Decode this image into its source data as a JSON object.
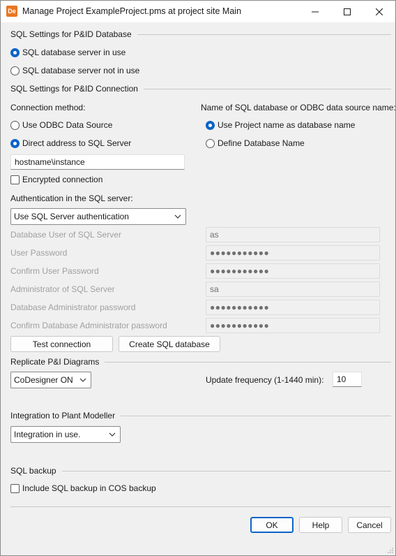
{
  "window": {
    "app_icon": "De",
    "title": "Manage Project ExampleProject.pms at project site Main"
  },
  "sql_db": {
    "heading": "SQL Settings for P&ID Database",
    "in_use": "SQL database server in use",
    "not_in_use": "SQL database server not in use"
  },
  "sql_conn": {
    "heading": "SQL Settings for P&ID Connection",
    "method_label": "Connection method:",
    "odbc": "Use ODBC Data Source",
    "direct": "Direct address to SQL Server",
    "server_value": "hostname\\instance",
    "encrypted": "Encrypted connection",
    "name_label": "Name of SQL database or ODBC data source name:",
    "use_project_name": "Use Project name as database name",
    "define_name": "Define Database Name",
    "auth_label": "Authentication in the SQL server:",
    "auth_value": "Use SQL Server authentication",
    "fields": [
      {
        "label": "Database User of SQL Server",
        "value": "as"
      },
      {
        "label": "User Password",
        "value": "●●●●●●●●●●●"
      },
      {
        "label": "Confirm User Password",
        "value": "●●●●●●●●●●●"
      },
      {
        "label": "Administrator of SQL Server",
        "value": "sa"
      },
      {
        "label": "Database Administrator password",
        "value": "●●●●●●●●●●●"
      },
      {
        "label": "Confirm Database Administrator password",
        "value": "●●●●●●●●●●●"
      }
    ],
    "test_button": "Test connection",
    "create_button": "Create SQL database"
  },
  "replicate": {
    "heading": "Replicate P&I Diagrams",
    "select_value": "CoDesigner ON",
    "freq_label": "Update frequency (1-1440 min):",
    "freq_value": "10"
  },
  "integration": {
    "heading": "Integration to Plant Modeller",
    "select_value": "Integration in use."
  },
  "backup": {
    "heading": "SQL backup",
    "include": "Include SQL backup in COS backup"
  },
  "footer": {
    "ok": "OK",
    "help": "Help",
    "cancel": "Cancel"
  },
  "colors": {
    "accent": "#0a64c8",
    "app_icon": "#e87722"
  }
}
